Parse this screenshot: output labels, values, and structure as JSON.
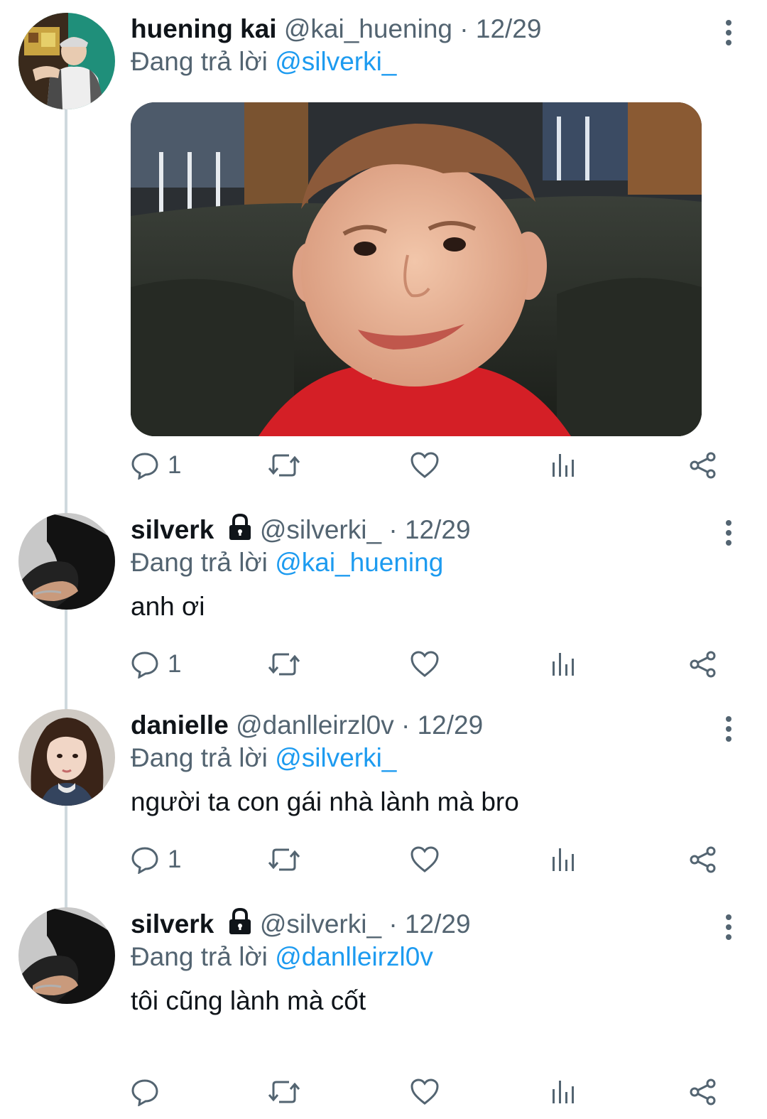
{
  "tweets": [
    {
      "display_name": "huening kai",
      "handle": "@kai_huening",
      "separator": " · ",
      "date": "12/29",
      "locked": false,
      "reply_prefix": "Đang trả lời ",
      "reply_to": "@silverki_",
      "text": "",
      "has_media": true,
      "reply_count": "1",
      "avatar_icon": "profile-photo"
    },
    {
      "display_name": "silverk",
      "handle": "@silverki_",
      "separator": " · ",
      "date": "12/29",
      "locked": true,
      "reply_prefix": "Đang trả lời ",
      "reply_to": "@kai_huening",
      "text": "anh ơi",
      "has_media": false,
      "reply_count": "1",
      "avatar_icon": "profile-photo"
    },
    {
      "display_name": "danielle",
      "handle": "@danlleirzl0v",
      "separator": " · ",
      "date": "12/29",
      "locked": false,
      "reply_prefix": "Đang trả lời ",
      "reply_to": "@silverki_",
      "text": "người ta con gái nhà lành mà bro",
      "has_media": false,
      "reply_count": "1",
      "avatar_icon": "profile-photo"
    },
    {
      "display_name": "silverk",
      "handle": "@silverki_",
      "separator": " · ",
      "date": "12/29",
      "locked": true,
      "reply_prefix": "Đang trả lời ",
      "reply_to": "@danlleirzl0v",
      "text": "tôi cũng lành mà cốt",
      "has_media": false,
      "reply_count": "",
      "avatar_icon": "profile-photo"
    }
  ],
  "icons": {
    "reply": "reply-icon",
    "retweet": "retweet-icon",
    "like": "heart-icon",
    "views": "analytics-icon",
    "share": "share-icon",
    "more": "more-options-icon",
    "lock": "lock-icon"
  },
  "colors": {
    "mention": "#1d9bf0",
    "secondary_text": "#536471",
    "primary_text": "#0f1419",
    "thread_line": "#cfd9de",
    "shirt_red": "#d41f26"
  }
}
